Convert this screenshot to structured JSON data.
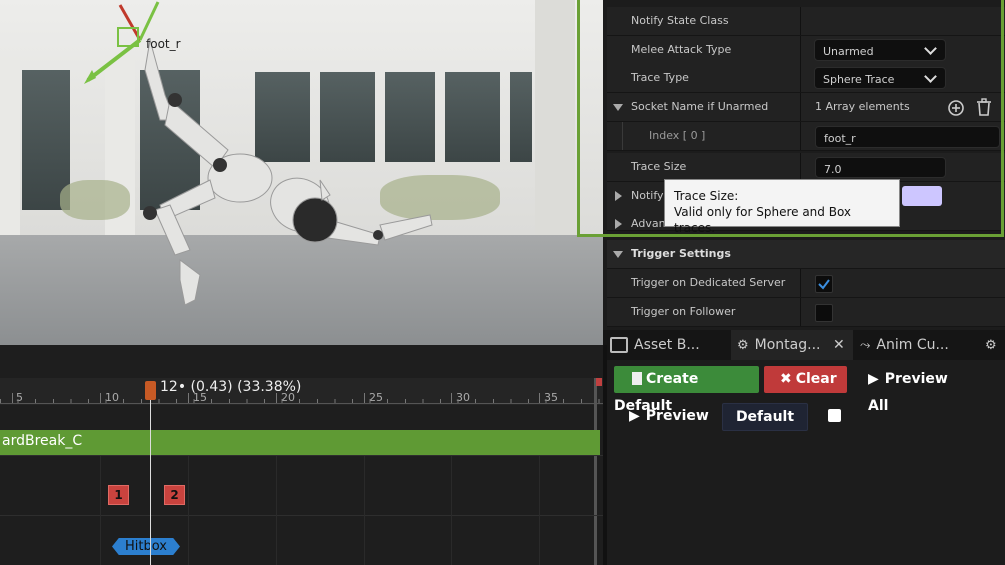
{
  "viewport": {
    "bone_label": "foot_r"
  },
  "details": {
    "rows": [
      {
        "label": "Notify State Class"
      },
      {
        "label": "Melee Attack Type",
        "value": "Unarmed"
      },
      {
        "label": "Trace Type",
        "value": "Sphere Trace"
      },
      {
        "label": "Socket Name if Unarmed",
        "value": "1 Array elements"
      },
      {
        "label": "Index [ 0 ]",
        "value": "foot_r"
      },
      {
        "label": "Trace Size",
        "value": "7.0"
      },
      {
        "label": "Notify"
      },
      {
        "label": "Advan"
      }
    ],
    "trigger_section": "Trigger Settings",
    "trigger_rows": [
      {
        "label": "Trigger on Dedicated Server",
        "checked": true
      },
      {
        "label": "Trigger on Follower",
        "checked": false
      }
    ],
    "tooltip": {
      "title": "Trace Size:",
      "body": "Valid only for Sphere and Box traces."
    },
    "accent_color": "#6aa035"
  },
  "tabs": [
    {
      "label": "Asset B..."
    },
    {
      "label": "Montag..."
    },
    {
      "label": "Anim Cu..."
    }
  ],
  "toolbar": {
    "create_default": "Create Default",
    "clear": "Clear",
    "preview_all": "Preview All",
    "preview": "Preview",
    "default": "Default"
  },
  "timeline": {
    "frame_readout": "12• (0.43) (33.38%)",
    "ticks": [
      "5",
      "10",
      "15",
      "20",
      "25",
      "30",
      "35"
    ],
    "track_name": "ardBreak_C",
    "markers": [
      "1",
      "2"
    ],
    "notify_label": "Hitbox"
  }
}
